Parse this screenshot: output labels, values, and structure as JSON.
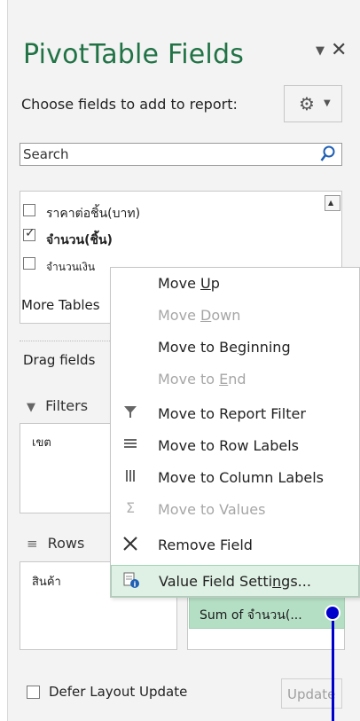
{
  "pane": {
    "title": "PivotTable Fields",
    "dropdown_glyph": "▼",
    "close_glyph": "✕",
    "choose_label": "Choose fields to add to report:",
    "settings_icon": "gear-icon"
  },
  "search": {
    "placeholder": "Search"
  },
  "fields": [
    {
      "label": "ราคาต่อชิ้น(บาท)",
      "checked": false
    },
    {
      "label": "จำนวน(ชิ้น)",
      "checked": true
    },
    {
      "label": "จำนวนเงิน",
      "checked": false
    }
  ],
  "more_tables": "More Tables",
  "drag_label": "Drag fields",
  "areas": {
    "filters": {
      "label": "Filters",
      "items": [
        "เขต"
      ]
    },
    "rows": {
      "label": "Rows",
      "items": [
        "สินค้า"
      ]
    },
    "values": {
      "items": [
        "Sum of จำนวน(..."
      ]
    }
  },
  "defer_label": "Defer Layout Update",
  "update_label": "Update",
  "context_menu": {
    "items": [
      {
        "pre": "Move ",
        "ul": "U",
        "post": "p",
        "enabled": true,
        "icon": ""
      },
      {
        "pre": "Move ",
        "ul": "D",
        "post": "own",
        "enabled": false,
        "icon": ""
      },
      {
        "pre": "Move to Be",
        "ul": "g",
        "post": "inning",
        "enabled": true,
        "icon": ""
      },
      {
        "pre": "Move to ",
        "ul": "E",
        "post": "nd",
        "enabled": false,
        "icon": ""
      },
      {
        "pre": "Move to Report Filter",
        "ul": "",
        "post": "",
        "enabled": true,
        "icon": "filter-icon"
      },
      {
        "pre": "Move to Row Labels",
        "ul": "",
        "post": "",
        "enabled": true,
        "icon": "rows-icon"
      },
      {
        "pre": "Move to Column Labels",
        "ul": "",
        "post": "",
        "enabled": true,
        "icon": "columns-icon"
      },
      {
        "pre": "Move to Values",
        "ul": "",
        "post": "",
        "enabled": false,
        "icon": "sigma-icon"
      },
      {
        "pre": "Remove Field",
        "ul": "",
        "post": "",
        "enabled": true,
        "icon": "remove-icon"
      },
      {
        "pre": "Value Field Setti",
        "ul": "n",
        "post": "gs...",
        "enabled": true,
        "icon": "value-settings-icon"
      }
    ]
  }
}
